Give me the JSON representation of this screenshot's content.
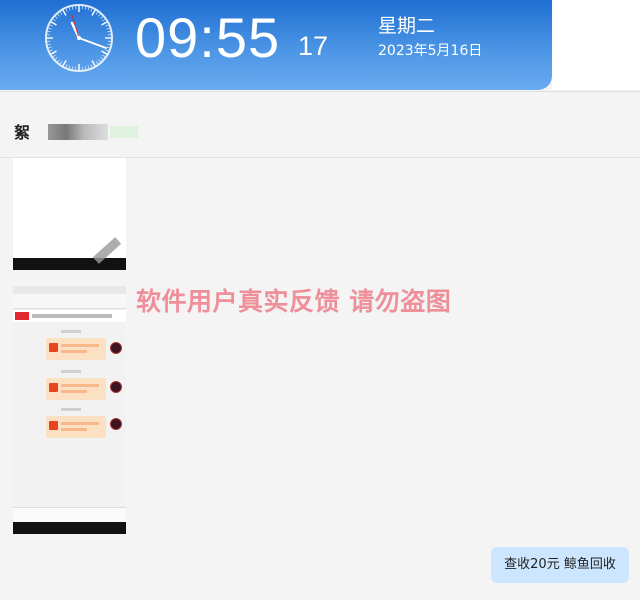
{
  "clock": {
    "time": "09:55",
    "seconds": "17",
    "weekday": "星期二",
    "date": "2023年5月16日"
  },
  "sender": {
    "name": "絮",
    "tag": ""
  },
  "watermark": "软件用户真实反馈  请勿盗图",
  "badge": "查收20元   鲸鱼回收",
  "colors": {
    "banner": "#1f6fd3",
    "watermark": "#ef8f9a",
    "badge_bg": "#cde6ff"
  }
}
